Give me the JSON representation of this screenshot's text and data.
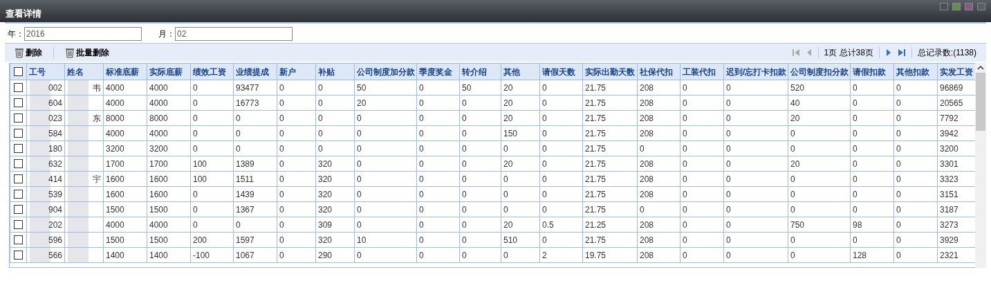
{
  "window": {
    "title": "查看详情"
  },
  "filters": [
    {
      "label": "年：",
      "value": "2016"
    },
    {
      "label": "月：",
      "value": "02"
    }
  ],
  "toolbar": {
    "buttons": [
      "删除",
      "批量删除"
    ],
    "pager": {
      "page_info": "1页 总计38页",
      "total": "总记录数:(1138)"
    }
  },
  "table": {
    "header_checked": false,
    "columns": [
      "工号",
      "姓名",
      "标准底薪",
      "实际底薪",
      "绩效工资",
      "业绩提成",
      "新户",
      "补贴",
      "公司制度加分款",
      "季度奖金",
      "转介绍",
      "其他",
      "请假天数",
      "实际出勤天数",
      "社保代扣",
      "工装代扣",
      "迟到/忘打卡扣款",
      "公司制度扣分款",
      "请假扣款",
      "其他扣款",
      "实发工资"
    ],
    "rows": [
      {
        "checked": false,
        "cells": [
          "002",
          "韦",
          "4000",
          "4000",
          "0",
          "93477",
          "0",
          "0",
          "50",
          "0",
          "50",
          "20",
          "0",
          "21.75",
          "208",
          "0",
          "0",
          "520",
          "0",
          "0",
          "96869"
        ]
      },
      {
        "checked": false,
        "cells": [
          "604",
          "",
          "4000",
          "4000",
          "0",
          "16773",
          "0",
          "0",
          "20",
          "0",
          "0",
          "20",
          "0",
          "21.75",
          "208",
          "0",
          "0",
          "40",
          "0",
          "0",
          "20565"
        ]
      },
      {
        "checked": false,
        "cells": [
          "023",
          "东",
          "8000",
          "8000",
          "0",
          "0",
          "0",
          "0",
          "0",
          "0",
          "0",
          "20",
          "0",
          "21.75",
          "208",
          "0",
          "0",
          "20",
          "0",
          "0",
          "7792"
        ]
      },
      {
        "checked": false,
        "cells": [
          "584",
          "",
          "4000",
          "4000",
          "0",
          "0",
          "0",
          "0",
          "0",
          "0",
          "0",
          "150",
          "0",
          "21.75",
          "208",
          "0",
          "0",
          "0",
          "0",
          "0",
          "3942"
        ]
      },
      {
        "checked": false,
        "cells": [
          "180",
          "",
          "3200",
          "3200",
          "0",
          "0",
          "0",
          "0",
          "0",
          "0",
          "0",
          "0",
          "0",
          "21.75",
          "0",
          "0",
          "0",
          "0",
          "0",
          "0",
          "3200"
        ]
      },
      {
        "checked": false,
        "cells": [
          "632",
          "",
          "1700",
          "1700",
          "100",
          "1389",
          "0",
          "320",
          "0",
          "0",
          "0",
          "20",
          "0",
          "21.75",
          "208",
          "0",
          "0",
          "20",
          "0",
          "0",
          "3301"
        ]
      },
      {
        "checked": false,
        "cells": [
          "414",
          "宇",
          "1600",
          "1600",
          "100",
          "1511",
          "0",
          "320",
          "0",
          "0",
          "0",
          "0",
          "0",
          "21.75",
          "208",
          "0",
          "0",
          "0",
          "0",
          "0",
          "3323"
        ]
      },
      {
        "checked": false,
        "cells": [
          "539",
          "",
          "1600",
          "1600",
          "0",
          "1439",
          "0",
          "320",
          "0",
          "0",
          "0",
          "0",
          "0",
          "21.75",
          "208",
          "0",
          "0",
          "0",
          "0",
          "0",
          "3151"
        ]
      },
      {
        "checked": false,
        "cells": [
          "904",
          "",
          "1500",
          "1500",
          "0",
          "1367",
          "0",
          "320",
          "0",
          "0",
          "0",
          "0",
          "0",
          "21.75",
          "0",
          "0",
          "0",
          "0",
          "0",
          "0",
          "3187"
        ]
      },
      {
        "checked": false,
        "cells": [
          "202",
          "",
          "4000",
          "4000",
          "0",
          "0",
          "0",
          "309",
          "0",
          "0",
          "0",
          "20",
          "0.5",
          "21.25",
          "208",
          "0",
          "0",
          "750",
          "98",
          "0",
          "3273"
        ]
      },
      {
        "checked": false,
        "cells": [
          "596",
          "",
          "1500",
          "1500",
          "200",
          "1597",
          "0",
          "320",
          "10",
          "0",
          "0",
          "510",
          "0",
          "21.75",
          "208",
          "0",
          "0",
          "0",
          "0",
          "0",
          "3929"
        ]
      },
      {
        "checked": false,
        "cells": [
          "566",
          "",
          "1400",
          "1400",
          "-100",
          "1067",
          "0",
          "290",
          "0",
          "0",
          "0",
          "0",
          "2",
          "19.75",
          "208",
          "0",
          "0",
          "0",
          "128",
          "0",
          "2321"
        ]
      }
    ]
  }
}
